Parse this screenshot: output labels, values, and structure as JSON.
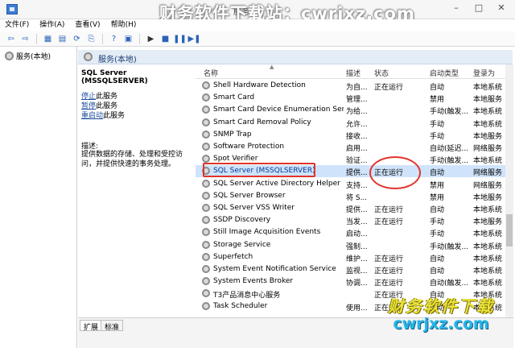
{
  "window": {
    "title": "服务",
    "watermark_top": "财务软件下载站：cwrjxz.com"
  },
  "menu": [
    "文件(F)",
    "操作(A)",
    "查看(V)",
    "帮助(H)"
  ],
  "tree": {
    "root": "服务(本地)"
  },
  "section": {
    "title": "服务(本地)"
  },
  "detail": {
    "service_name": "SQL Server (MSSQLSERVER)",
    "actions": [
      {
        "link": "停止",
        "suffix": "此服务"
      },
      {
        "link": "暂停",
        "suffix": "此服务"
      },
      {
        "link": "重启动",
        "suffix": "此服务"
      }
    ],
    "desc_label": "描述:",
    "desc_text": "提供数据的存储、处理和受控访问，并提供快速的事务处理。"
  },
  "table": {
    "headers": {
      "name": "名称",
      "desc": "描述",
      "status": "状态",
      "start": "启动类型",
      "logon": "登录为"
    },
    "rows": [
      {
        "name": "Shell Hardware Detection",
        "desc": "为自...",
        "status": "正在运行",
        "start": "自动",
        "logon": "本地系统"
      },
      {
        "name": "Smart Card",
        "desc": "管理...",
        "status": "",
        "start": "禁用",
        "logon": "本地服务"
      },
      {
        "name": "Smart Card Device Enumeration Ser...",
        "desc": "为给...",
        "status": "",
        "start": "手动(触发...",
        "logon": "本地系统"
      },
      {
        "name": "Smart Card Removal Policy",
        "desc": "允许...",
        "status": "",
        "start": "手动",
        "logon": "本地系统"
      },
      {
        "name": "SNMP Trap",
        "desc": "接收...",
        "status": "",
        "start": "手动",
        "logon": "本地服务"
      },
      {
        "name": "Software Protection",
        "desc": "启用...",
        "status": "",
        "start": "自动(延迟...",
        "logon": "网络服务"
      },
      {
        "name": "Spot Verifier",
        "desc": "验证...",
        "status": "",
        "start": "手动(触发...",
        "logon": "本地系统"
      },
      {
        "name": "SQL Server (MSSQLSERVER)",
        "desc": "提供...",
        "status": "正在运行",
        "start": "自动",
        "logon": "网络服务"
      },
      {
        "name": "SQL Server Active Directory Helper",
        "desc": "支持...",
        "status": "",
        "start": "禁用",
        "logon": "网络服务"
      },
      {
        "name": "SQL Server Browser",
        "desc": "将 S...",
        "status": "",
        "start": "禁用",
        "logon": "本地服务"
      },
      {
        "name": "SQL Server VSS Writer",
        "desc": "提供...",
        "status": "正在运行",
        "start": "自动",
        "logon": "本地系统"
      },
      {
        "name": "SSDP Discovery",
        "desc": "当发...",
        "status": "正在运行",
        "start": "手动",
        "logon": "本地服务"
      },
      {
        "name": "Still Image Acquisition Events",
        "desc": "启动...",
        "status": "",
        "start": "手动",
        "logon": "本地系统"
      },
      {
        "name": "Storage Service",
        "desc": "强制...",
        "status": "",
        "start": "手动(触发...",
        "logon": "本地系统"
      },
      {
        "name": "Superfetch",
        "desc": "维护...",
        "status": "正在运行",
        "start": "自动",
        "logon": "本地系统"
      },
      {
        "name": "System Event Notification Service",
        "desc": "监视...",
        "status": "正在运行",
        "start": "自动",
        "logon": "本地系统"
      },
      {
        "name": "System Events Broker",
        "desc": "协调...",
        "status": "正在运行",
        "start": "自动(触发...",
        "logon": "本地系统"
      },
      {
        "name": "T3产品消息中心服务",
        "desc": "",
        "status": "正在运行",
        "start": "自动",
        "logon": "本地系统"
      },
      {
        "name": "Task Scheduler",
        "desc": "使用...",
        "status": "正在运行",
        "start": "自动",
        "logon": "本地系统"
      }
    ]
  },
  "tabs": [
    "扩展",
    "标准"
  ],
  "watermark_bottom": {
    "cn": "财务软件下载",
    "url": "cwrjxz.com"
  }
}
